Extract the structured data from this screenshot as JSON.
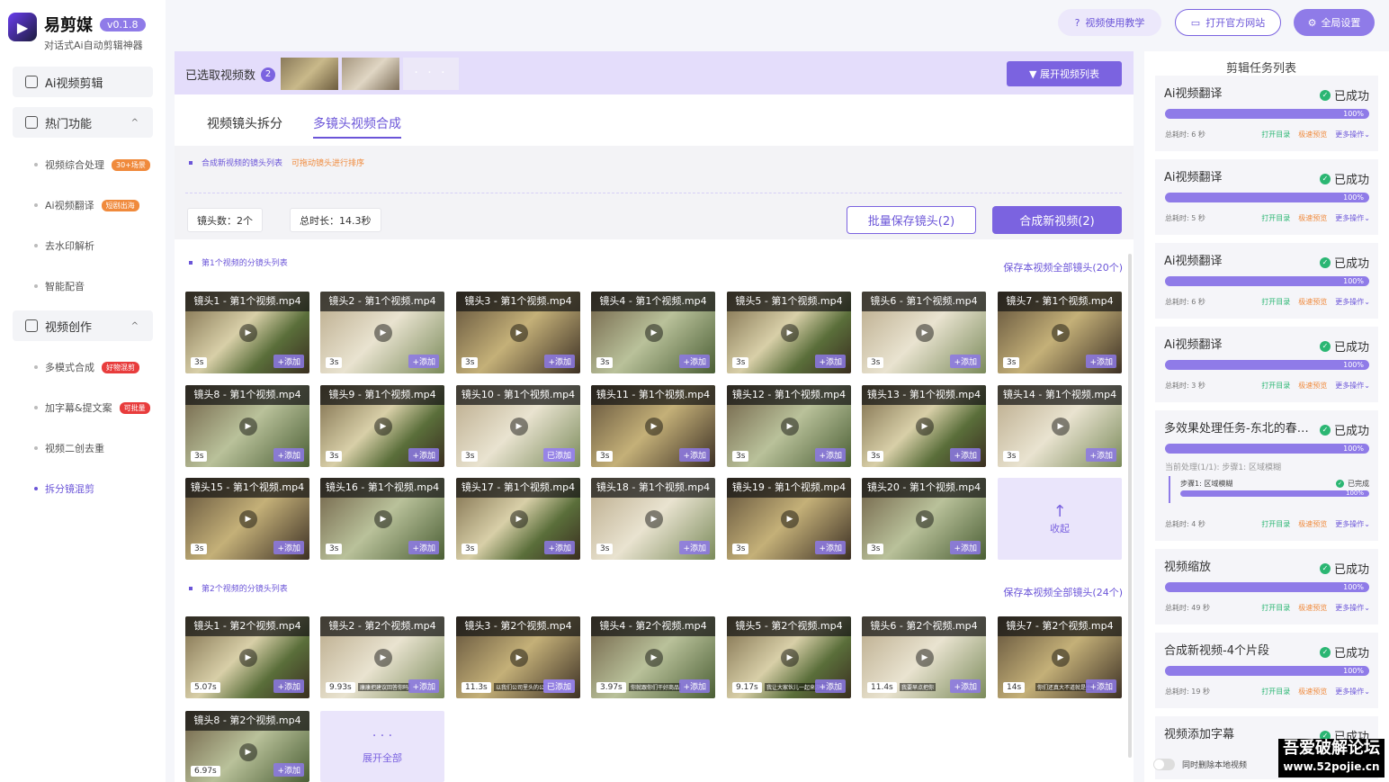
{
  "app": {
    "title": "易剪媒",
    "version": "v0.1.8",
    "subtitle": "对话式Ai自动剪辑神器",
    "logo_char": "▶"
  },
  "sidebar": {
    "items": [
      {
        "label": "Ai视频剪辑",
        "type": "main"
      },
      {
        "label": "热门功能",
        "type": "main",
        "chevron": "^"
      },
      {
        "label": "视频综合处理",
        "type": "sub",
        "tag": "30+场景",
        "tag_color": "#f08a3c"
      },
      {
        "label": "Ai视频翻译",
        "type": "sub",
        "tag": "短剧出海",
        "tag_color": "#f08a3c"
      },
      {
        "label": "去水印解析",
        "type": "sub"
      },
      {
        "label": "智能配音",
        "type": "sub"
      },
      {
        "label": "视频创作",
        "type": "main",
        "chevron": "^"
      },
      {
        "label": "多模式合成",
        "type": "sub",
        "tag": "好物混剪",
        "tag_color": "#e83c3c"
      },
      {
        "label": "加字幕&提文案",
        "type": "sub",
        "tag": "可批量",
        "tag_color": "#e83c3c"
      },
      {
        "label": "视频二创去重",
        "type": "sub"
      },
      {
        "label": "拆分镜混剪",
        "type": "sub",
        "active": true
      }
    ]
  },
  "topbar": {
    "tutorial": "视频使用教学",
    "website": "打开官方网站",
    "settings": "全局设置"
  },
  "selection": {
    "label": "已选取视频数",
    "count": "2",
    "more": "· · ·",
    "expand_button": "▼ 展开视频列表"
  },
  "tabs": [
    {
      "label": "视频镜头拆分",
      "active": false
    },
    {
      "label": "多镜头视频合成",
      "active": true
    }
  ],
  "compose": {
    "section_title": "合成新视频的镜头列表",
    "hint": "可拖动镜头进行排序",
    "shot_count": "镜头数：2个",
    "total_duration": "总时长：14.3秒",
    "batch_save": "批量保存镜头(2)",
    "compose_button": "合成新视频(2)"
  },
  "video1": {
    "section_title": "第1个视频的分镜头列表",
    "save_all": "保存本视频全部镜头(20个)",
    "collapse": "收起",
    "collapse_icon": "↑",
    "shots": [
      {
        "title": "镜头1 - 第1个视频.mp4",
        "dur": "3s",
        "add": "+添加"
      },
      {
        "title": "镜头2 - 第1个视频.mp4",
        "dur": "3s",
        "add": "+添加"
      },
      {
        "title": "镜头3 - 第1个视频.mp4",
        "dur": "3s",
        "add": "+添加"
      },
      {
        "title": "镜头4 - 第1个视频.mp4",
        "dur": "3s",
        "add": "+添加"
      },
      {
        "title": "镜头5 - 第1个视频.mp4",
        "dur": "3s",
        "add": "+添加"
      },
      {
        "title": "镜头6 - 第1个视频.mp4",
        "dur": "3s",
        "add": "+添加"
      },
      {
        "title": "镜头7 - 第1个视频.mp4",
        "dur": "3s",
        "add": "+添加"
      },
      {
        "title": "镜头8 - 第1个视频.mp4",
        "dur": "3s",
        "add": "+添加"
      },
      {
        "title": "镜头9 - 第1个视频.mp4",
        "dur": "3s",
        "add": "+添加"
      },
      {
        "title": "镜头10 - 第1个视频.mp4",
        "dur": "3s",
        "add": "已添加"
      },
      {
        "title": "镜头11 - 第1个视频.mp4",
        "dur": "3s",
        "add": "+添加"
      },
      {
        "title": "镜头12 - 第1个视频.mp4",
        "dur": "3s",
        "add": "+添加"
      },
      {
        "title": "镜头13 - 第1个视频.mp4",
        "dur": "3s",
        "add": "+添加"
      },
      {
        "title": "镜头14 - 第1个视频.mp4",
        "dur": "3s",
        "add": "+添加"
      },
      {
        "title": "镜头15 - 第1个视频.mp4",
        "dur": "3s",
        "add": "+添加"
      },
      {
        "title": "镜头16 - 第1个视频.mp4",
        "dur": "3s",
        "add": "+添加"
      },
      {
        "title": "镜头17 - 第1个视频.mp4",
        "dur": "3s",
        "add": "+添加"
      },
      {
        "title": "镜头18 - 第1个视频.mp4",
        "dur": "3s",
        "add": "+添加"
      },
      {
        "title": "镜头19 - 第1个视频.mp4",
        "dur": "3s",
        "add": "+添加"
      },
      {
        "title": "镜头20 - 第1个视频.mp4",
        "dur": "3s",
        "add": "+添加"
      }
    ]
  },
  "video2": {
    "section_title": "第2个视频的分镜头列表",
    "save_all": "保存本视频全部镜头(24个)",
    "expand_all": "展开全部",
    "expand_icon": "· · ·",
    "shots": [
      {
        "title": "镜头1 - 第2个视频.mp4",
        "dur": "5.07s",
        "add": "+添加",
        "sub": ""
      },
      {
        "title": "镜头2 - 第2个视频.mp4",
        "dur": "9.93s",
        "add": "+添加",
        "sub": "康康把建议回答你吗"
      },
      {
        "title": "镜头3 - 第2个视频.mp4",
        "dur": "11.3s",
        "add": "已添加",
        "sub": "以我们公司里头的公民"
      },
      {
        "title": "镜头4 - 第2个视频.mp4",
        "dur": "3.97s",
        "add": "+添加",
        "sub": "你就跟你们干好商品"
      },
      {
        "title": "镜头5 - 第2个视频.mp4",
        "dur": "9.17s",
        "add": "+添加",
        "sub": "我让大家伙儿一起来游游"
      },
      {
        "title": "镜头6 - 第2个视频.mp4",
        "dur": "11.4s",
        "add": "+添加",
        "sub": "我要早点把你"
      },
      {
        "title": "镜头7 - 第2个视频.mp4",
        "dur": "14s",
        "add": "+添加",
        "sub": "你们还真大不道就是主"
      },
      {
        "title": "镜头8 - 第2个视频.mp4",
        "dur": "6.97s",
        "add": "+添加",
        "sub": ""
      }
    ]
  },
  "tasks": {
    "title": "剪辑任务列表",
    "items": [
      {
        "name": "Ai视频翻译",
        "status": "已成功",
        "progress": "100%",
        "time": "总耗时: 6 秒",
        "open": "打开目录",
        "preview": "极速预览",
        "more": "更多操作"
      },
      {
        "name": "Ai视频翻译",
        "status": "已成功",
        "progress": "100%",
        "time": "总耗时: 5 秒",
        "open": "打开目录",
        "preview": "极速预览",
        "more": "更多操作"
      },
      {
        "name": "Ai视频翻译",
        "status": "已成功",
        "progress": "100%",
        "time": "总耗时: 6 秒",
        "open": "打开目录",
        "preview": "极速预览",
        "more": "更多操作"
      },
      {
        "name": "Ai视频翻译",
        "status": "已成功",
        "progress": "100%",
        "time": "总耗时: 3 秒",
        "open": "打开目录",
        "preview": "极速预览",
        "more": "更多操作"
      },
      {
        "name": "多效果处理任务-东北的春天...",
        "status": "已成功",
        "progress": "100%",
        "time": "总耗时: 4 秒",
        "open": "打开目录",
        "preview": "极速预览",
        "more": "更多操作",
        "detail": "当前处理(1/1): 步骤1:  区域模糊",
        "step": "步骤1:  区域模糊",
        "step_status": "已完成",
        "step_progress": "100%"
      },
      {
        "name": "视频缩放",
        "status": "已成功",
        "progress": "100%",
        "time": "总耗时: 49 秒",
        "open": "打开目录",
        "preview": "极速预览",
        "more": "更多操作"
      },
      {
        "name": "合成新视频-4个片段",
        "status": "已成功",
        "progress": "100%",
        "time": "总耗时: 19 秒",
        "open": "打开目录",
        "preview": "极速预览",
        "more": "更多操作"
      },
      {
        "name": "视频添加字幕",
        "status": "已成功"
      }
    ],
    "delete_local": "同时删除本地视频"
  },
  "watermark": {
    "line1": "吾爱破解论坛",
    "line2": "www.52pojie.cn"
  }
}
